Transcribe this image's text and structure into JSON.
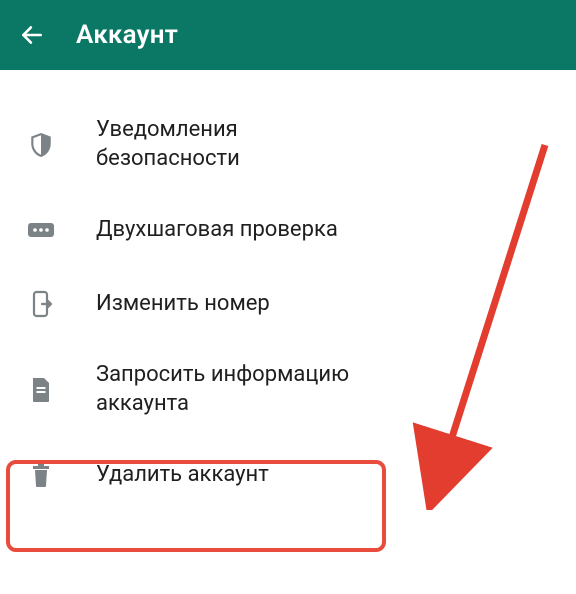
{
  "header": {
    "title": "Аккаунт"
  },
  "menu": {
    "items": [
      {
        "label": "Уведомления безопасности"
      },
      {
        "label": "Двухшаговая проверка"
      },
      {
        "label": "Изменить номер"
      },
      {
        "label": "Запросить информацию аккаунта"
      },
      {
        "label": "Удалить аккаунт"
      }
    ]
  },
  "annotation": {
    "highlight_color": "#e74c3c"
  }
}
